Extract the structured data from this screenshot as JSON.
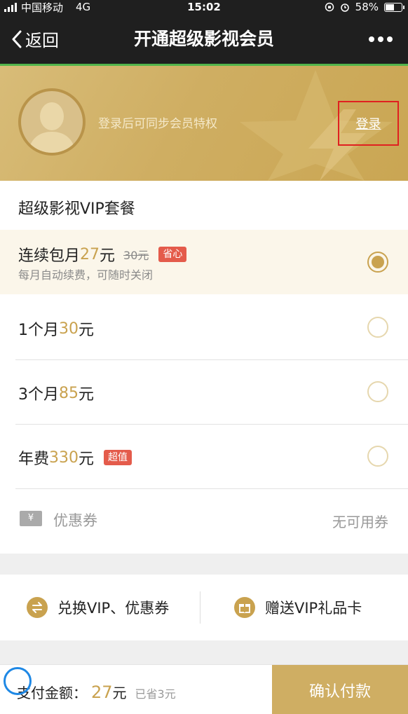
{
  "status_bar": {
    "carrier": "中国移动",
    "network": "4G",
    "time": "15:02",
    "battery_percent": "58%",
    "battery_level": 0.58
  },
  "nav": {
    "back_label": "返回",
    "title": "开通超级影视会员"
  },
  "banner": {
    "login_hint": "登录后可同步会员特权",
    "login_label": "登录"
  },
  "section_title": "超级影视VIP套餐",
  "plans": [
    {
      "name": "连续包月",
      "price": "27",
      "unit": "元",
      "original_price": "30元",
      "tag": "省心",
      "subtitle": "每月自动续费，可随时关闭",
      "selected": true
    },
    {
      "name": "1个月",
      "price": "30",
      "unit": "元",
      "selected": false
    },
    {
      "name": "3个月",
      "price": "85",
      "unit": "元",
      "selected": false
    },
    {
      "name": "年费",
      "price": "330",
      "unit": "元",
      "tag": "超值",
      "selected": false
    }
  ],
  "coupon": {
    "icon_text": "¥",
    "label": "优惠券",
    "value": "无可用券"
  },
  "actions": {
    "exchange_label": "兑换VIP、优惠券",
    "gift_label": "赠送VIP礼品卡"
  },
  "bottom": {
    "pay_label": "支付金额：",
    "amount": "27",
    "unit": "元",
    "saved": "已省3元",
    "confirm_label": "确认付款"
  },
  "colors": {
    "accent_gold": "#c9a24f",
    "nav_bg": "#1f1f1f",
    "tag_red": "#e45b4b",
    "highlight_box": "#e02020"
  }
}
